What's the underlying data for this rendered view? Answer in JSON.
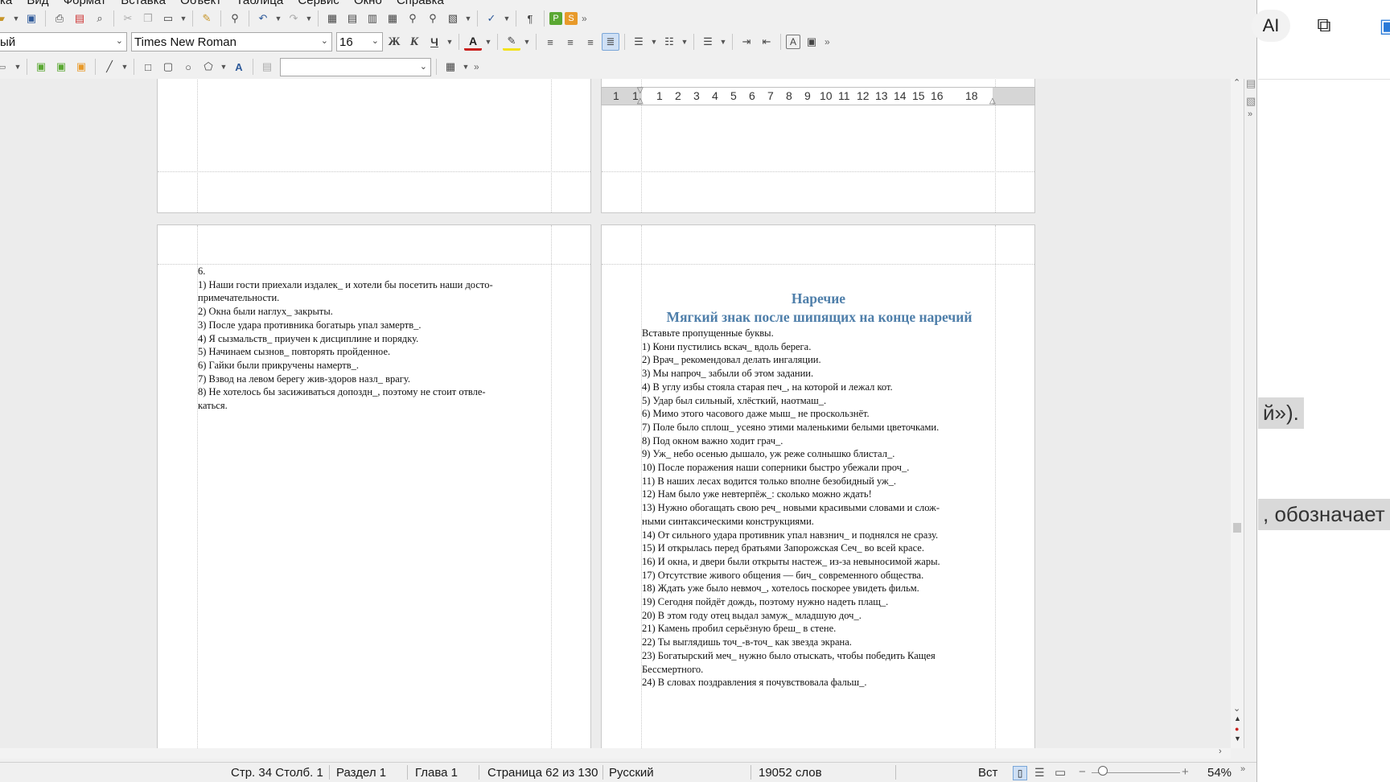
{
  "menubar": [
    "ка",
    "Вид",
    "Формат",
    "Вставка",
    "Объект",
    "Таблица",
    "Сервис",
    "Окно",
    "Справка"
  ],
  "formatting": {
    "style": "ый",
    "font_name": "Times New Roman",
    "font_size": "16",
    "bold": "Ж",
    "italic": "К",
    "underline": "Ч",
    "font_color_letter": "A",
    "vertical_letter": "A"
  },
  "ruler": {
    "ticks": [
      "1",
      "1",
      "1",
      "2",
      "3",
      "4",
      "5",
      "6",
      "7",
      "8",
      "9",
      "10",
      "11",
      "12",
      "13",
      "14",
      "15",
      "16",
      "18"
    ]
  },
  "left_page": {
    "lines": [
      "6.",
      "1) Наши гости приехали издалек_ и хотели бы посетить наши досто-",
      "примечательности.",
      "2) Окна были наглух_ закрыты.",
      "3) После удара противника богатырь упал замертв_.",
      "4) Я сызмальств_ приучен к дисциплине и порядку.",
      "5) Начинаем сызнов_ повторять пройденное.",
      "6) Гайки были прикручены намертв_.",
      "7) Взвод на левом берегу жив-здоров назл_ врагу.",
      "8) Не хотелось бы засиживаться допоздн_, поэтому не стоит отвле-",
      "каться."
    ]
  },
  "right_page": {
    "title": "Наречие",
    "subtitle": "Мягкий знак после шипящих на конце наречий",
    "lines": [
      "Вставьте пропущенные буквы.",
      "1) Кони пустились вскач_ вдоль берега.",
      "2) Врач_ рекомендовал делать ингаляции.",
      "3) Мы напроч_ забыли об этом задании.",
      "4) В углу избы стояла старая печ_, на которой и лежал кот.",
      "5) Удар был сильный, хлёсткий, наотмаш_.",
      "6) Мимо этого часового даже мыш_ не проскользнёт.",
      "7) Поле было сплош_ усеяно этими маленькими белыми цветочками.",
      "8) Под окном важно ходит грач_.",
      "9) Уж_ небо осенью дышало, уж реже солнышко блистал_.",
      "10) После поражения наши соперники быстро убежали проч_.",
      "11) В наших лесах водится только вполне безобидный уж_.",
      "12) Нам было уже невтерпёж_: сколько можно ждать!",
      "13) Нужно обогащать свою реч_ новыми красивыми словами и слож-",
      "ными синтаксическими конструкциями.",
      "14) От сильного удара противник упал навзнич_ и поднялся не сразу.",
      "15) И открылась перед братьями Запорожская Сеч_ во всей красе.",
      "16) И окна, и двери были открыты настеж_ из-за невыносимой жары.",
      "17) Отсутствие живого общения — бич_ современного общества.",
      "18) Ждать уже было невмоч_, хотелось поскорее увидеть фильм.",
      "19) Сегодня пойдёт дождь, поэтому нужно надеть плащ_.",
      "20) В этом году отец выдал замуж_ младшую доч_.",
      "21) Камень пробил серьёзную бреш_ в стене.",
      "22) Ты выглядишь точ_-в-точ_ как звезда экрана.",
      "23) Богатырский меч_ нужно было отыскать, чтобы победить Кащея",
      "Бессмертного.",
      "24) В словах поздравления я почувствовала фальш_."
    ]
  },
  "statusbar": {
    "position": "Стр. 34 Столб. 1",
    "section": "Раздел 1",
    "chapter": "Глава 1",
    "page": "Страница 62 из 130",
    "language": "Русский",
    "words": "19052 слов",
    "insert_mode": "Вст",
    "zoom": "54%"
  },
  "right_panel": {
    "ai_label": "AI",
    "snippet1": "й»).",
    "snippet2": ", обозначает"
  }
}
